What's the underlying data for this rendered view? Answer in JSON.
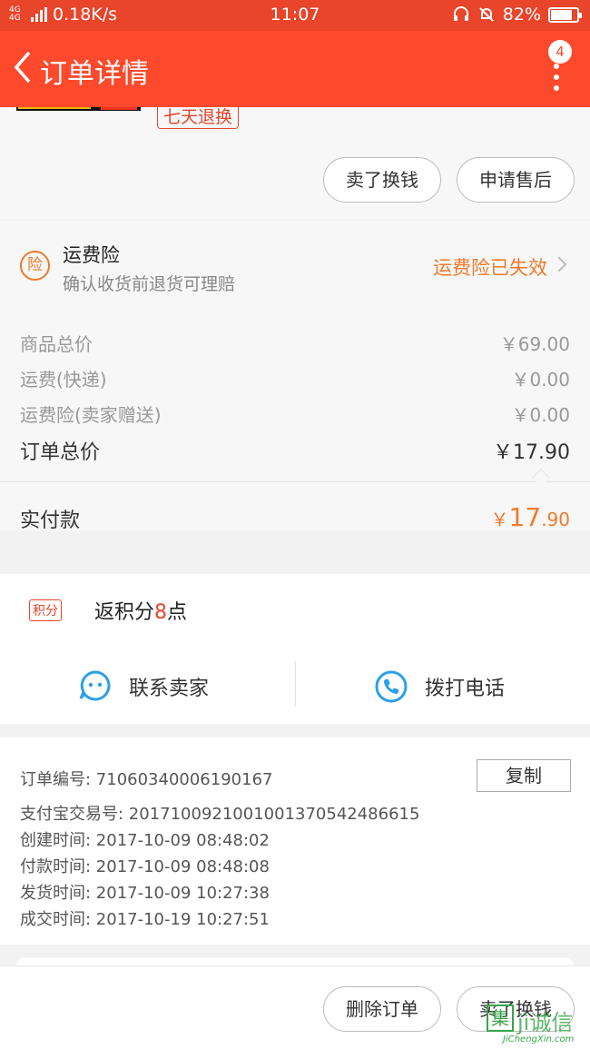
{
  "status_bar": {
    "network": "4G 4G",
    "speed": "0.18K/s",
    "time": "11:07",
    "battery": "82%",
    "battery_level": 0.82
  },
  "nav": {
    "back_icon": "chevron-left-icon",
    "title": "订单详情",
    "more_icon": "more-vertical-icon",
    "badge": "4"
  },
  "product": {
    "tag": "七天退换",
    "buttons": [
      "卖了换钱",
      "申请售后"
    ]
  },
  "insurance": {
    "badge": "险",
    "title": "运费险",
    "subtitle": "确认收货前退货可理赔",
    "status": "运费险已失效"
  },
  "fees": [
    {
      "label": "商品总价",
      "value": "￥69.00"
    },
    {
      "label": "运费(快递)",
      "value": "￥0.00"
    },
    {
      "label": "运费险(卖家赠送)",
      "value": "￥0.00"
    }
  ],
  "total": {
    "label": "订单总价",
    "value": "￥17.90"
  },
  "paid": {
    "label": "实付款",
    "currency": "￥",
    "integer": "17",
    "decimal": ".90"
  },
  "points": {
    "tag": "积分",
    "prefix": "返积分",
    "num": "8",
    "suffix": "点"
  },
  "actions": {
    "contact": {
      "label": "联系卖家",
      "icon": "chat-bubble-icon"
    },
    "call": {
      "label": "拨打电话",
      "icon": "phone-icon"
    }
  },
  "order_info": {
    "copy_label": "复制",
    "rows": [
      "订单编号:  71060340006190167",
      "支付宝交易号:  2017100921001001370542486615",
      "创建时间:  2017-10-09 08:48:02",
      "付款时间:  2017-10-09 08:48:08",
      "发货时间:  2017-10-09 10:27:38",
      "成交时间:  2017-10-19 10:27:51"
    ]
  },
  "bottom": {
    "buttons": [
      "删除订单",
      "卖了换钱"
    ]
  },
  "watermark": {
    "logo": "集",
    "cn": "jì诚信",
    "en": "JiChengXin.com"
  },
  "colors": {
    "brand": "#fd4a2c",
    "accent": "#f07a2a",
    "link_blue": "#2aa0e6"
  }
}
